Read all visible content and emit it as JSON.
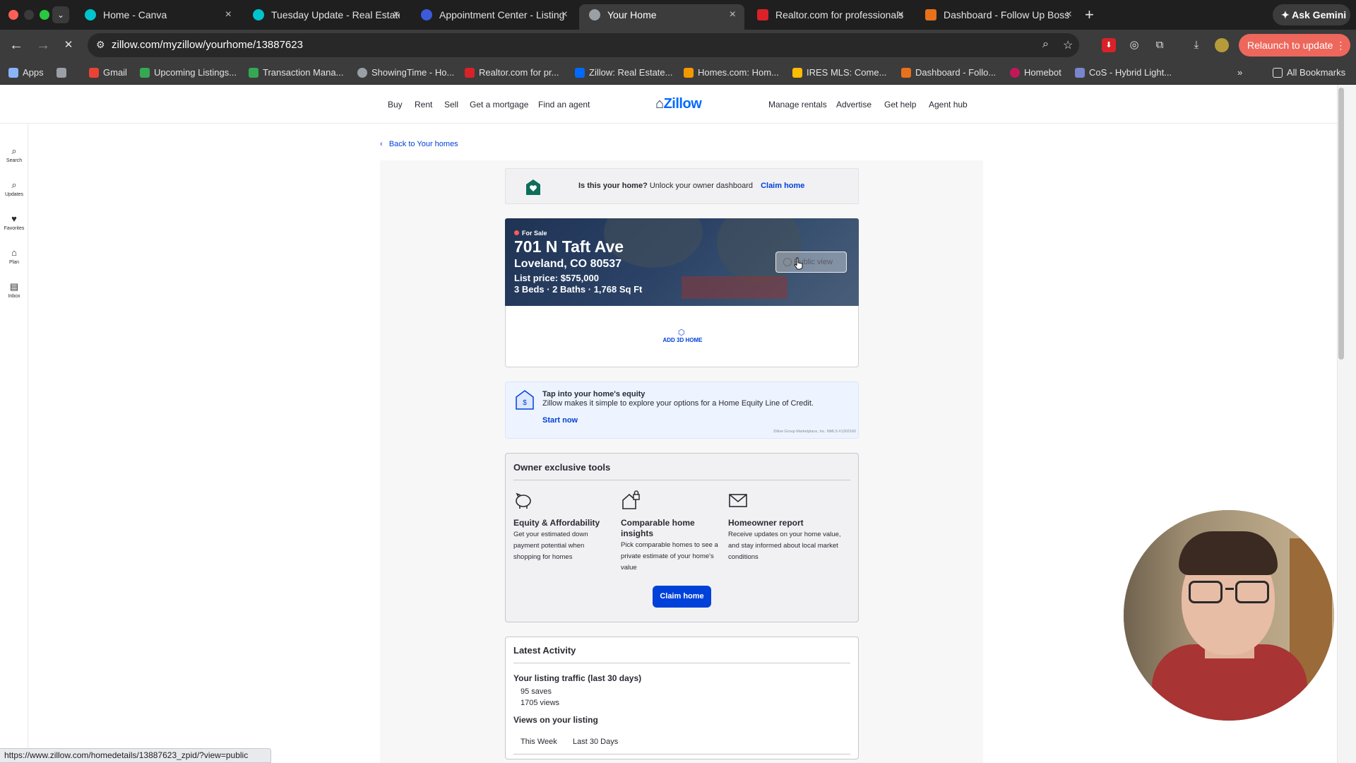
{
  "browser": {
    "tabs": [
      {
        "label": "Home - Canva",
        "favicon_color": "#00c4cc"
      },
      {
        "label": "Tuesday Update - Real Estate",
        "favicon_color": "#00c4cc"
      },
      {
        "label": "Appointment Center - Listing",
        "favicon_color": "#3b5bdb"
      },
      {
        "label": "Your Home",
        "favicon_color": "#9aa0a6"
      },
      {
        "label": "Realtor.com for professionals",
        "favicon_color": "#d92228"
      },
      {
        "label": "Dashboard - Follow Up Boss",
        "favicon_color": "#e8711a"
      }
    ],
    "ask_gemini": "Ask Gemini",
    "url": "zillow.com/myzillow/yourhome/13887623",
    "relaunch": "Relaunch to update",
    "bookmarks": [
      {
        "label": "Apps",
        "color": "#8ab4f8"
      },
      {
        "label": "",
        "color": "#9aa0a6"
      },
      {
        "label": "Gmail",
        "color": "#ea4335"
      },
      {
        "label": "Upcoming Listings...",
        "color": "#34a853"
      },
      {
        "label": "Transaction Mana...",
        "color": "#34a853"
      },
      {
        "label": "ShowingTime - Ho...",
        "color": "#9aa0a6"
      },
      {
        "label": "Realtor.com for pr...",
        "color": "#d92228"
      },
      {
        "label": "Zillow: Real Estate...",
        "color": "#006aff"
      },
      {
        "label": "Homes.com: Hom...",
        "color": "#f29900"
      },
      {
        "label": "IRES MLS: Come...",
        "color": "#fbbc04"
      },
      {
        "label": "Dashboard - Follo...",
        "color": "#e8711a"
      },
      {
        "label": "Homebot",
        "color": "#c2185b"
      },
      {
        "label": "CoS - Hybrid Light...",
        "color": "#7986cb"
      }
    ],
    "all_bookmarks": "All Bookmarks",
    "status_url": "https://www.zillow.com/homedetails/13887623_zpid/?view=public"
  },
  "zillow": {
    "nav_left": [
      "Buy",
      "Rent",
      "Sell",
      "Get a mortgage",
      "Find an agent"
    ],
    "logo": "Zillow",
    "nav_right": [
      "Manage rentals",
      "Advertise",
      "Get help",
      "Agent hub"
    ],
    "rail": [
      "Search",
      "Updates",
      "Favorites",
      "Plan",
      "Inbox"
    ],
    "back_link": "Back to Your homes",
    "claim_banner": {
      "question": "Is this your home?",
      "text": "Unlock your owner dashboard",
      "link": "Claim home"
    },
    "listing": {
      "status": "For Sale",
      "street": "701 N Taft Ave",
      "city": "Loveland, CO 80537",
      "price": "List price: $575,000",
      "facts": "3 Beds · 2 Baths · 1,768 Sq Ft",
      "public_view": "Public view",
      "add_3d": "ADD 3D HOME"
    },
    "equity": {
      "title": "Tap into your home's equity",
      "desc": "Zillow makes it simple to explore your options for a Home Equity Line of Credit.",
      "cta": "Start now",
      "legal": "Zillow Group Marketplace, Inc. NMLS #1303160"
    },
    "tools": {
      "title": "Owner exclusive tools",
      "items": [
        {
          "name": "Equity & Affordability",
          "desc": "Get your estimated down payment potential when shopping for homes"
        },
        {
          "name": "Comparable home insights",
          "desc": "Pick comparable homes to see a private estimate of your home's value"
        },
        {
          "name": "Homeowner report",
          "desc": "Receive updates on your home value, and stay informed about local market conditions"
        }
      ],
      "claim_button": "Claim home"
    },
    "activity": {
      "title": "Latest Activity",
      "traffic_heading": "Your listing traffic (last 30 days)",
      "saves": "95 saves",
      "views": "1705 views",
      "views_heading": "Views on your listing",
      "range_tabs": [
        "This Week",
        "Last 30 Days"
      ]
    }
  }
}
